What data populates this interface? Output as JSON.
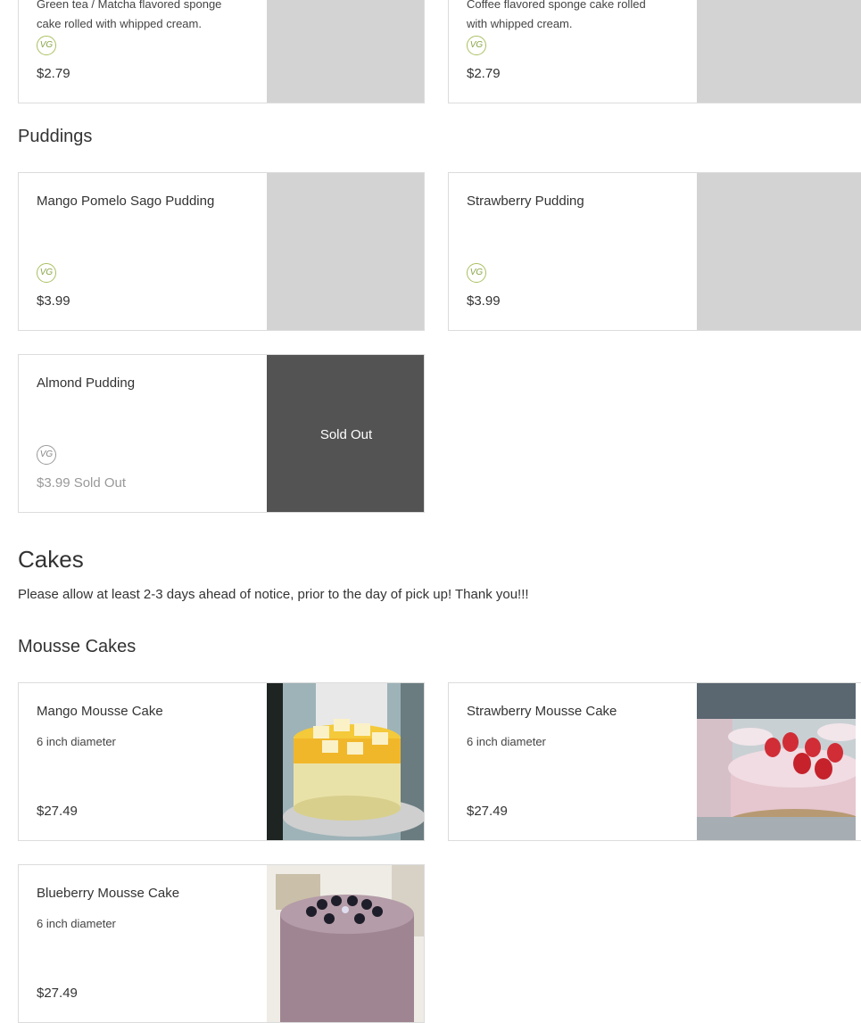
{
  "top_cards": [
    {
      "desc": "Green tea / Matcha flavored sponge cake rolled with whipped cream.",
      "badge": "VG",
      "price": "$2.79"
    },
    {
      "desc": "Coffee flavored sponge cake rolled with whipped cream.",
      "badge": "VG",
      "price": "$2.79"
    }
  ],
  "puddings": {
    "title": "Puddings",
    "items": [
      {
        "name": "Mango Pomelo Sago Pudding",
        "badge": "VG",
        "price": "$3.99"
      },
      {
        "name": "Strawberry Pudding",
        "badge": "VG",
        "price": "$3.99"
      },
      {
        "name": "Almond Pudding",
        "badge": "VG",
        "price": "$3.99 Sold Out",
        "overlay": "Sold Out"
      }
    ]
  },
  "cakes": {
    "title": "Cakes",
    "note": "Please allow at least 2-3 days ahead of notice, prior to the day of pick up! Thank you!!!",
    "mousse_title": "Mousse Cakes",
    "items": [
      {
        "name": "Mango Mousse Cake",
        "desc": "6 inch diameter",
        "price": "$27.49"
      },
      {
        "name": "Strawberry Mousse Cake",
        "desc": "6 inch diameter",
        "price": "$27.49"
      },
      {
        "name": "Blueberry Mousse Cake",
        "desc": "6 inch diameter",
        "price": "$27.49"
      }
    ]
  }
}
